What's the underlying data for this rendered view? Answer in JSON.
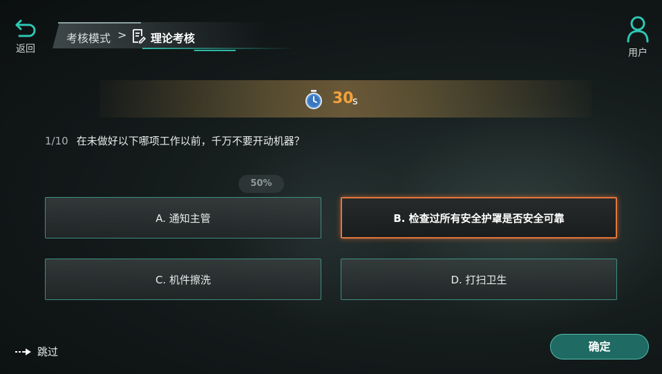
{
  "nav": {
    "back_label": "返回",
    "user_label": "用户"
  },
  "breadcrumb": {
    "mode": "考核模式",
    "separator": ">",
    "current": "理论考核"
  },
  "timer": {
    "value": "30",
    "unit": "s"
  },
  "question": {
    "index": "1/10",
    "text": "在未做好以下哪项工作以前，千万不要开动机器？"
  },
  "percent_badge": "50%",
  "options": [
    {
      "label": "A. 通知主管",
      "selected": false
    },
    {
      "label": "B. 检查过所有安全护罩是否安全可靠",
      "selected": true
    },
    {
      "label": "C. 机件擦洗",
      "selected": false
    },
    {
      "label": "D. 打扫卫生",
      "selected": false
    }
  ],
  "footer": {
    "skip_label": "跳过",
    "confirm_label": "确定"
  },
  "colors": {
    "accent": "#2fb9a8",
    "selected_border": "#e8763c",
    "timer_text": "#f3a33b",
    "confirm_bg": "#1f6a62"
  },
  "icons": {
    "back": "undo-arrow-icon",
    "doc": "document-edit-icon",
    "user": "user-icon",
    "clock": "stopwatch-icon",
    "skip": "dashed-arrow-icon"
  }
}
